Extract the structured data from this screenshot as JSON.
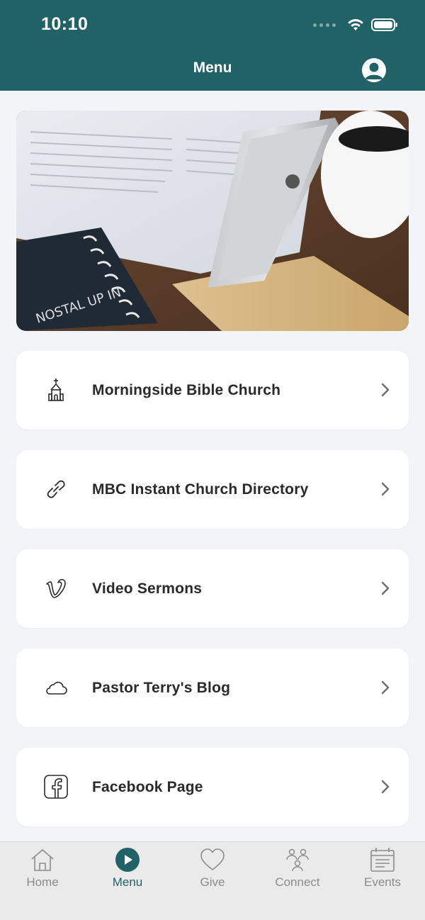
{
  "status_bar": {
    "time": "10:10"
  },
  "header": {
    "title": "Menu"
  },
  "menu_items": [
    {
      "label": "Morningside Bible Church",
      "icon": "church-icon"
    },
    {
      "label": "MBC Instant Church Directory",
      "icon": "link-icon"
    },
    {
      "label": "Video Sermons",
      "icon": "vimeo-icon"
    },
    {
      "label": "Pastor Terry's Blog",
      "icon": "cloud-icon"
    },
    {
      "label": "Facebook Page",
      "icon": "facebook-icon"
    }
  ],
  "tabs": [
    {
      "label": "Home",
      "icon": "home-icon",
      "active": false
    },
    {
      "label": "Menu",
      "icon": "play-icon",
      "active": true
    },
    {
      "label": "Give",
      "icon": "heart-icon",
      "active": false
    },
    {
      "label": "Connect",
      "icon": "people-icon",
      "active": false
    },
    {
      "label": "Events",
      "icon": "calendar-icon",
      "active": false
    }
  ],
  "colors": {
    "brand": "#216266",
    "background": "#f3f4f8",
    "tab_inactive": "#8b8b8b"
  }
}
